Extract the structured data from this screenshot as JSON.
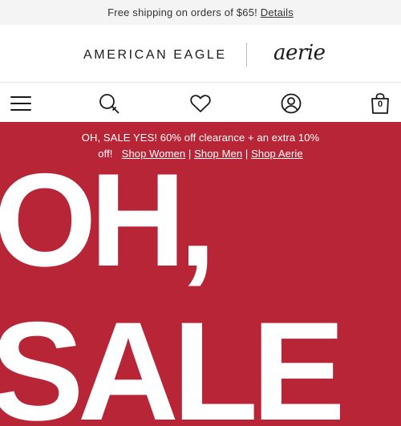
{
  "promo": {
    "text": "Free shipping on orders of $65!",
    "link": "Details"
  },
  "brands": {
    "primary": "AMERICAN EAGLE",
    "secondary": "aerie"
  },
  "nav": {
    "menu_icon": "hamburger-menu-icon",
    "search_icon": "search-icon",
    "favorites_icon": "heart-icon",
    "account_icon": "user-account-icon",
    "bag_icon": "shopping-bag-icon",
    "bag_count": "0"
  },
  "hero": {
    "background_color": "#b82536",
    "text": "OH, SALE YES! 60% off clearance + an extra 10% off!",
    "links": [
      "Shop Women",
      "Shop Men",
      "Shop Aerie"
    ],
    "separator": "|",
    "headline_line1": "OH,",
    "headline_line2": "SALE"
  }
}
